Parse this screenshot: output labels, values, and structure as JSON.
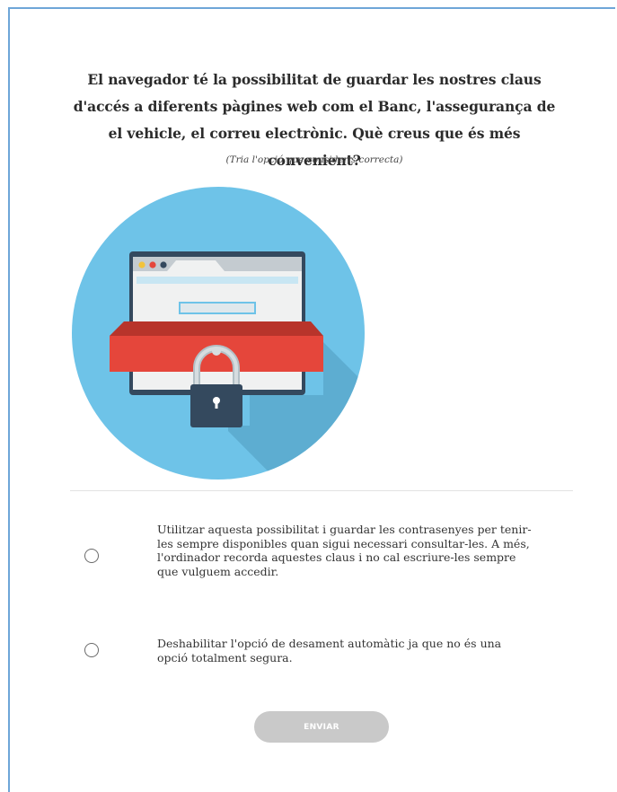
{
  "quiz": {
    "question": "El navegador té la possibilitat de guardar les nostres claus d'accés a diferents pàgines web com el Banc, l'assegurança de el vehicle, el correu electrònic. Què creus que és més convenient?",
    "hint": "(Tria l'opció que consideris correcta)",
    "illustration_icon": "browser-padlock-icon",
    "options": [
      {
        "text": "Utilitzar aquesta possibilitat i guardar les contrasenyes per tenir-les sempre disponibles quan sigui necessari consultar-les. A més, l'ordinador recorda aquestes claus i no cal escriure-les sempre que vulguem accedir.",
        "selected": false
      },
      {
        "text": "Deshabilitar l'opció de desament automàtic ja que no és una opció totalment segura.",
        "selected": false
      }
    ],
    "submit_label": "ENVIAR"
  },
  "colors": {
    "frame_border": "#6ea6d8",
    "circle": "#6ec3e8",
    "band": "#e5463b",
    "padlock": "#34495e",
    "button_disabled": "#c9c9c9"
  }
}
